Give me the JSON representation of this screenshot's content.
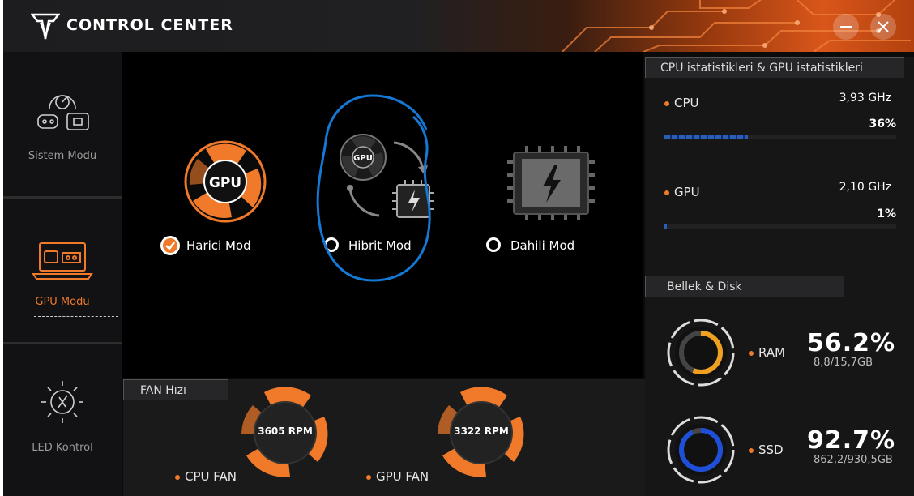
{
  "app": {
    "title": "CONTROL CENTER"
  },
  "window": {
    "minimize_icon": "minimize-icon",
    "close_icon": "close-icon"
  },
  "sidebar": {
    "items": [
      {
        "label": "Sistem Modu",
        "icon": "system-mode-icon",
        "active": false
      },
      {
        "label": "GPU Modu",
        "icon": "gpu-mode-icon",
        "active": true
      },
      {
        "label": "LED Kontrol",
        "icon": "led-icon",
        "active": false
      }
    ]
  },
  "modes": {
    "options": [
      {
        "label": "Harici Mod",
        "icon": "gpu-fan-icon",
        "selected": true
      },
      {
        "label": "Hibrit Mod",
        "icon": "hybrid-icon",
        "selected": false
      },
      {
        "label": "Dahili Mod",
        "icon": "chip-icon",
        "selected": false
      }
    ],
    "gpu_badge": "GPU"
  },
  "fan": {
    "title": "FAN Hızı",
    "cpu": {
      "label": "CPU FAN",
      "rpm": "3605 RPM"
    },
    "gpu": {
      "label": "GPU FAN",
      "rpm": "3322 RPM"
    }
  },
  "stats": {
    "title": "CPU istatistikleri & GPU istatistikleri",
    "cpu": {
      "label": "CPU",
      "freq": "3,93 GHz",
      "percent": "36%",
      "usage": 0.36
    },
    "gpu": {
      "label": "GPU",
      "freq": "2,10 GHz",
      "percent": "1%",
      "usage": 0.01
    }
  },
  "memory": {
    "title": "Bellek & Disk",
    "ram": {
      "label": "RAM",
      "percent": "56.2%",
      "detail": "8,8/15,7GB",
      "usage": 0.562
    },
    "ssd": {
      "label": "SSD",
      "percent": "92.7%",
      "detail": "862,2/930,5GB",
      "usage": 0.927
    }
  },
  "colors": {
    "accent": "#f07a2a",
    "cpu_bar": "#2a5db8",
    "ram_ring": "#f0a020",
    "ssd_ring": "#1e4fd8",
    "annotation": "#1478d4"
  }
}
